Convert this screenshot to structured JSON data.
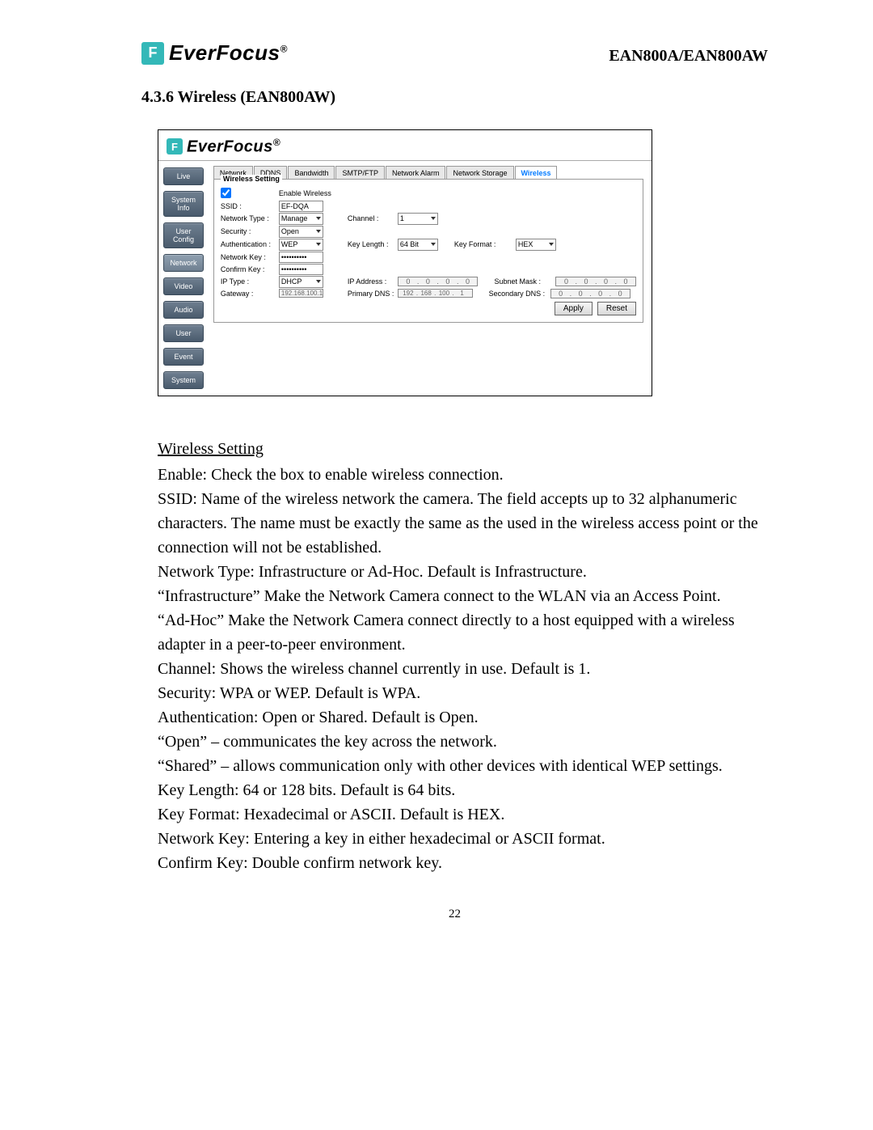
{
  "header": {
    "logo_text": "EverFocus",
    "logo_mark": "F",
    "model": "EAN800A/EAN800AW"
  },
  "section_heading": "4.3.6 Wireless (EAN800AW)",
  "screenshot": {
    "logo_text": "EverFocus",
    "sidebar": [
      "Live",
      "System Info",
      "User Config",
      "Network",
      "Video",
      "Audio",
      "User",
      "Event",
      "System"
    ],
    "sidebar_active": 3,
    "tabs": [
      "Network",
      "DDNS",
      "Bandwidth",
      "SMTP/FTP",
      "Network Alarm",
      "Network Storage",
      "Wireless"
    ],
    "tab_active": 6,
    "fieldset_title": "Wireless Setting",
    "enable_label": "Enable Wireless",
    "enable_checked": true,
    "fields": {
      "ssid_label": "SSID :",
      "ssid_value": "EF-DQA",
      "network_type_label": "Network Type :",
      "network_type_value": "Manage",
      "channel_label": "Channel :",
      "channel_value": "1",
      "security_label": "Security :",
      "security_value": "Open",
      "authentication_label": "Authentication :",
      "authentication_value": "WEP",
      "key_length_label": "Key Length :",
      "key_length_value": "64 Bit",
      "key_format_label": "Key Format :",
      "key_format_value": "HEX",
      "network_key_label": "Network Key :",
      "network_key_value": "••••••••••",
      "confirm_key_label": "Confirm Key :",
      "confirm_key_value": "••••••••••",
      "ip_type_label": "IP Type :",
      "ip_type_value": "DHCP",
      "ip_address_label": "IP Address :",
      "ip_address_value": [
        "0",
        "0",
        "0",
        "0"
      ],
      "subnet_mask_label": "Subnet Mask :",
      "subnet_mask_value": [
        "0",
        "0",
        "0",
        "0"
      ],
      "gateway_label": "Gateway :",
      "gateway_value": [
        "192",
        "168",
        "100",
        "1"
      ],
      "primary_dns_label": "Primary DNS :",
      "primary_dns_value": [
        "192",
        "168",
        "100",
        "1"
      ],
      "secondary_dns_label": "Secondary DNS :",
      "secondary_dns_value": [
        "0",
        "0",
        "0",
        "0"
      ]
    },
    "buttons": {
      "apply": "Apply",
      "reset": "Reset"
    }
  },
  "body": {
    "heading": "Wireless Setting",
    "paragraphs": [
      "Enable: Check the box to enable wireless connection.",
      "SSID: Name of the wireless network the camera. The field accepts up to 32 alphanumeric characters. The name must be exactly the same as the used in the wireless access point or the connection will not be established.",
      "Network Type: Infrastructure or Ad-Hoc. Default is Infrastructure.",
      "“Infrastructure” Make the Network Camera connect to the WLAN via an Access Point.",
      "“Ad-Hoc” Make the Network Camera connect directly to a host equipped with a wireless adapter in a peer-to-peer environment.",
      "Channel: Shows the wireless channel currently in use. Default is 1.",
      "Security: WPA or WEP. Default is WPA.",
      "Authentication: Open or Shared. Default is Open.",
      "“Open” – communicates the key across the network.",
      "“Shared” – allows communication only with other devices with identical WEP settings.",
      "Key Length: 64 or 128 bits. Default is 64 bits.",
      "Key Format: Hexadecimal or ASCII. Default is HEX.",
      "Network Key: Entering a key in either hexadecimal or ASCII format.",
      "Confirm Key: Double confirm network key."
    ]
  },
  "page_number": "22"
}
